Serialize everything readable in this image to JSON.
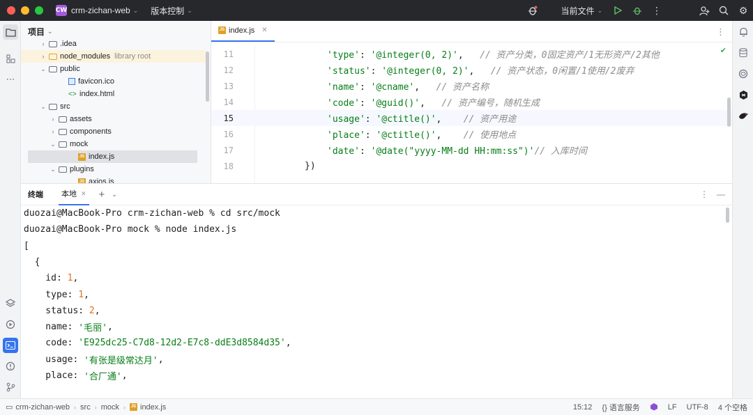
{
  "window": {
    "project_badge": "CW",
    "project_name": "crm-zichan-web",
    "vcs_menu": "版本控制",
    "run_config": "当前文件"
  },
  "project_pane": {
    "title": "项目",
    "items": [
      {
        "label": ".idea",
        "extra": ""
      },
      {
        "label": "node_modules",
        "extra": "library root"
      },
      {
        "label": "public",
        "extra": ""
      },
      {
        "label": "favicon.ico",
        "extra": ""
      },
      {
        "label": "index.html",
        "extra": ""
      },
      {
        "label": "src",
        "extra": ""
      },
      {
        "label": "assets",
        "extra": ""
      },
      {
        "label": "components",
        "extra": ""
      },
      {
        "label": "mock",
        "extra": ""
      },
      {
        "label": "index.js",
        "extra": ""
      },
      {
        "label": "plugins",
        "extra": ""
      },
      {
        "label": "axios.js",
        "extra": ""
      }
    ]
  },
  "editor": {
    "tab_label": "index.js",
    "tab_icon_text": "JS",
    "lines": [
      {
        "num": "11",
        "key": "'type'",
        "sep": ": ",
        "val": "'@integer(0, 2)'",
        "tail": ",   ",
        "comment": "// 资产分类，0固定资产/1无形资产/2其他"
      },
      {
        "num": "12",
        "key": "'status'",
        "sep": ": ",
        "val": "'@integer(0, 2)'",
        "tail": ",   ",
        "comment": "// 资产状态，0闲置/1使用/2废弃"
      },
      {
        "num": "13",
        "key": "'name'",
        "sep": ": ",
        "val": "'@cname'",
        "tail": ",   ",
        "comment": "// 资产名称"
      },
      {
        "num": "14",
        "key": "'code'",
        "sep": ": ",
        "val": "'@guid()'",
        "tail": ",   ",
        "comment": "// 资产编号，随机生成"
      },
      {
        "num": "15",
        "key": "'usage'",
        "sep": ": ",
        "val": "'@ctitle()'",
        "tail": ",    ",
        "comment": "// 资产用途"
      },
      {
        "num": "16",
        "key": "'place'",
        "sep": ": ",
        "val": "'@ctitle()'",
        "tail": ",    ",
        "comment": "// 使用地点"
      },
      {
        "num": "17",
        "key": "'date'",
        "sep": ": ",
        "val": "'@date(\"yyyy-MM-dd HH:mm:ss\")'",
        "tail": "",
        "comment": "// 入库时间"
      },
      {
        "num": "18",
        "key": "",
        "sep": "",
        "val": "",
        "tail": "})",
        "comment": ""
      }
    ]
  },
  "terminal": {
    "title": "终端",
    "tab_label": "本地",
    "lines": [
      "duozai@MacBook-Pro crm-zichan-web % cd src/mock",
      "duozai@MacBook-Pro mock % node index.js",
      "[",
      "  {"
    ],
    "fields": [
      {
        "key": "    id: ",
        "value": "1",
        "kind": "num"
      },
      {
        "key": "    type: ",
        "value": "1",
        "kind": "num"
      },
      {
        "key": "    status: ",
        "value": "2",
        "kind": "num"
      },
      {
        "key": "    name: ",
        "value": "'毛丽'",
        "kind": "str"
      },
      {
        "key": "    code: ",
        "value": "'E925dc25-C7d8-12d2-E7c8-ddE3d8584d35'",
        "kind": "str"
      },
      {
        "key": "    usage: ",
        "value": "'有张是级常达月'",
        "kind": "str"
      },
      {
        "key": "    place: ",
        "value": "'合厂通'",
        "kind": "str"
      }
    ]
  },
  "statusbar": {
    "crumbs": [
      "crm-zichan-web",
      "src",
      "mock",
      "index.js"
    ],
    "position": "15:12",
    "lang_services": "{} 语言服务",
    "line_sep": "LF",
    "encoding": "UTF-8",
    "indent": "4 个空格"
  }
}
